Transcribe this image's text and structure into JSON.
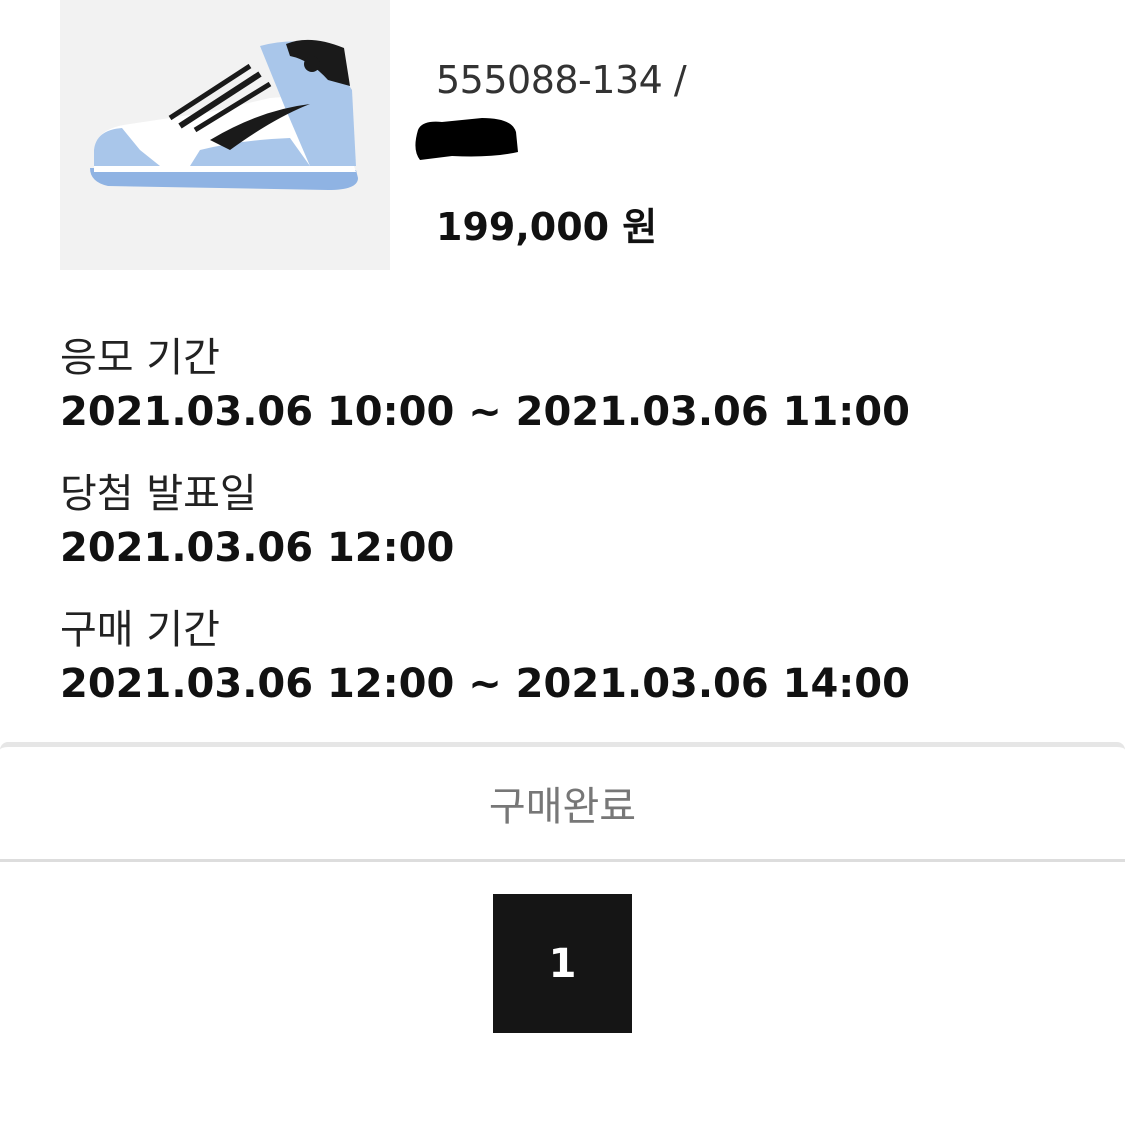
{
  "product": {
    "image_icon": "sneaker-image",
    "code": "555088-134 /",
    "price": "199,000 원"
  },
  "schedule": {
    "apply": {
      "label": "응모 기간",
      "value": "2021.03.06 10:00 ~ 2021.03.06 11:00"
    },
    "announce": {
      "label": "당첨 발표일",
      "value": "2021.03.06 12:00"
    },
    "purchase": {
      "label": "구매 기간",
      "value": "2021.03.06 12:00 ~ 2021.03.06 14:00"
    }
  },
  "status": {
    "label": "구매완료"
  },
  "pagination": {
    "current_page": "1"
  },
  "colors": {
    "thumb_bg": "#f2f2f2",
    "sneaker_blue": "#a9c6ea",
    "page_button": "#151515",
    "status_text": "#777777"
  }
}
